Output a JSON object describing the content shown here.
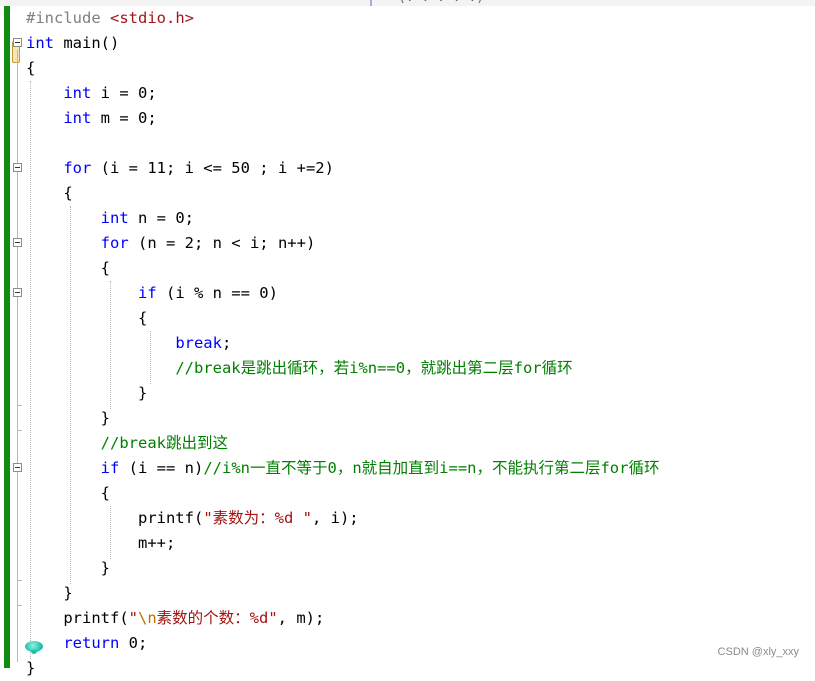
{
  "editor": {
    "top_tab_fragment": "(. . . . .)",
    "watermark": "CSDN @xly_xxy",
    "lines": [
      [
        {
          "t": "#include ",
          "c": "pp"
        },
        {
          "t": "<stdio.h>",
          "c": "hdr"
        }
      ],
      [
        {
          "t": "int",
          "c": "kw"
        },
        {
          "t": " main()",
          "c": "fn"
        }
      ],
      [
        {
          "t": "{",
          "c": "fn"
        }
      ],
      [
        {
          "t": "    ",
          "c": "fn"
        },
        {
          "t": "int",
          "c": "kw"
        },
        {
          "t": " i = 0;",
          "c": "fn"
        }
      ],
      [
        {
          "t": "    ",
          "c": "fn"
        },
        {
          "t": "int",
          "c": "kw"
        },
        {
          "t": " m = 0;",
          "c": "fn"
        }
      ],
      [
        {
          "t": "",
          "c": "fn"
        }
      ],
      [
        {
          "t": "    ",
          "c": "fn"
        },
        {
          "t": "for",
          "c": "kw"
        },
        {
          "t": " (i = 11; i <= 50 ; i +=2)",
          "c": "fn"
        }
      ],
      [
        {
          "t": "    {",
          "c": "fn"
        }
      ],
      [
        {
          "t": "        ",
          "c": "fn"
        },
        {
          "t": "int",
          "c": "kw"
        },
        {
          "t": " n = 0;",
          "c": "fn"
        }
      ],
      [
        {
          "t": "        ",
          "c": "fn"
        },
        {
          "t": "for",
          "c": "kw"
        },
        {
          "t": " (n = 2; n < i; n++)",
          "c": "fn"
        }
      ],
      [
        {
          "t": "        {",
          "c": "fn"
        }
      ],
      [
        {
          "t": "            ",
          "c": "fn"
        },
        {
          "t": "if",
          "c": "kw"
        },
        {
          "t": " (i % n == 0)",
          "c": "fn"
        }
      ],
      [
        {
          "t": "            {",
          "c": "fn"
        }
      ],
      [
        {
          "t": "                ",
          "c": "fn"
        },
        {
          "t": "break",
          "c": "kw"
        },
        {
          "t": ";",
          "c": "fn"
        }
      ],
      [
        {
          "t": "                ",
          "c": "fn"
        },
        {
          "t": "//break是跳出循环，若i%n==0，就跳出第二层for循环",
          "c": "cm"
        }
      ],
      [
        {
          "t": "            }",
          "c": "fn"
        }
      ],
      [
        {
          "t": "        }",
          "c": "fn"
        }
      ],
      [
        {
          "t": "        ",
          "c": "fn"
        },
        {
          "t": "//break跳出到这",
          "c": "cm"
        }
      ],
      [
        {
          "t": "        ",
          "c": "fn"
        },
        {
          "t": "if",
          "c": "kw"
        },
        {
          "t": " (i == n)",
          "c": "fn"
        },
        {
          "t": "//i%n一直不等于0，n就自加直到i==n，不能执行第二层for循环",
          "c": "cm"
        }
      ],
      [
        {
          "t": "        {",
          "c": "fn"
        }
      ],
      [
        {
          "t": "            printf(",
          "c": "fn"
        },
        {
          "t": "\"素数为：%d \"",
          "c": "str"
        },
        {
          "t": ", i);",
          "c": "fn"
        }
      ],
      [
        {
          "t": "            m++;",
          "c": "fn"
        }
      ],
      [
        {
          "t": "        }",
          "c": "fn"
        }
      ],
      [
        {
          "t": "    }",
          "c": "fn"
        }
      ],
      [
        {
          "t": "    printf(",
          "c": "fn"
        },
        {
          "t": "\"",
          "c": "str"
        },
        {
          "t": "\\n",
          "c": "esc"
        },
        {
          "t": "素数的个数：%d\"",
          "c": "str"
        },
        {
          "t": ", m);",
          "c": "fn"
        }
      ],
      [
        {
          "t": "    ",
          "c": "fn"
        },
        {
          "t": "return",
          "c": "kw"
        },
        {
          "t": " 0;",
          "c": "fn"
        }
      ],
      [
        {
          "t": "}",
          "c": "fn"
        }
      ]
    ]
  }
}
